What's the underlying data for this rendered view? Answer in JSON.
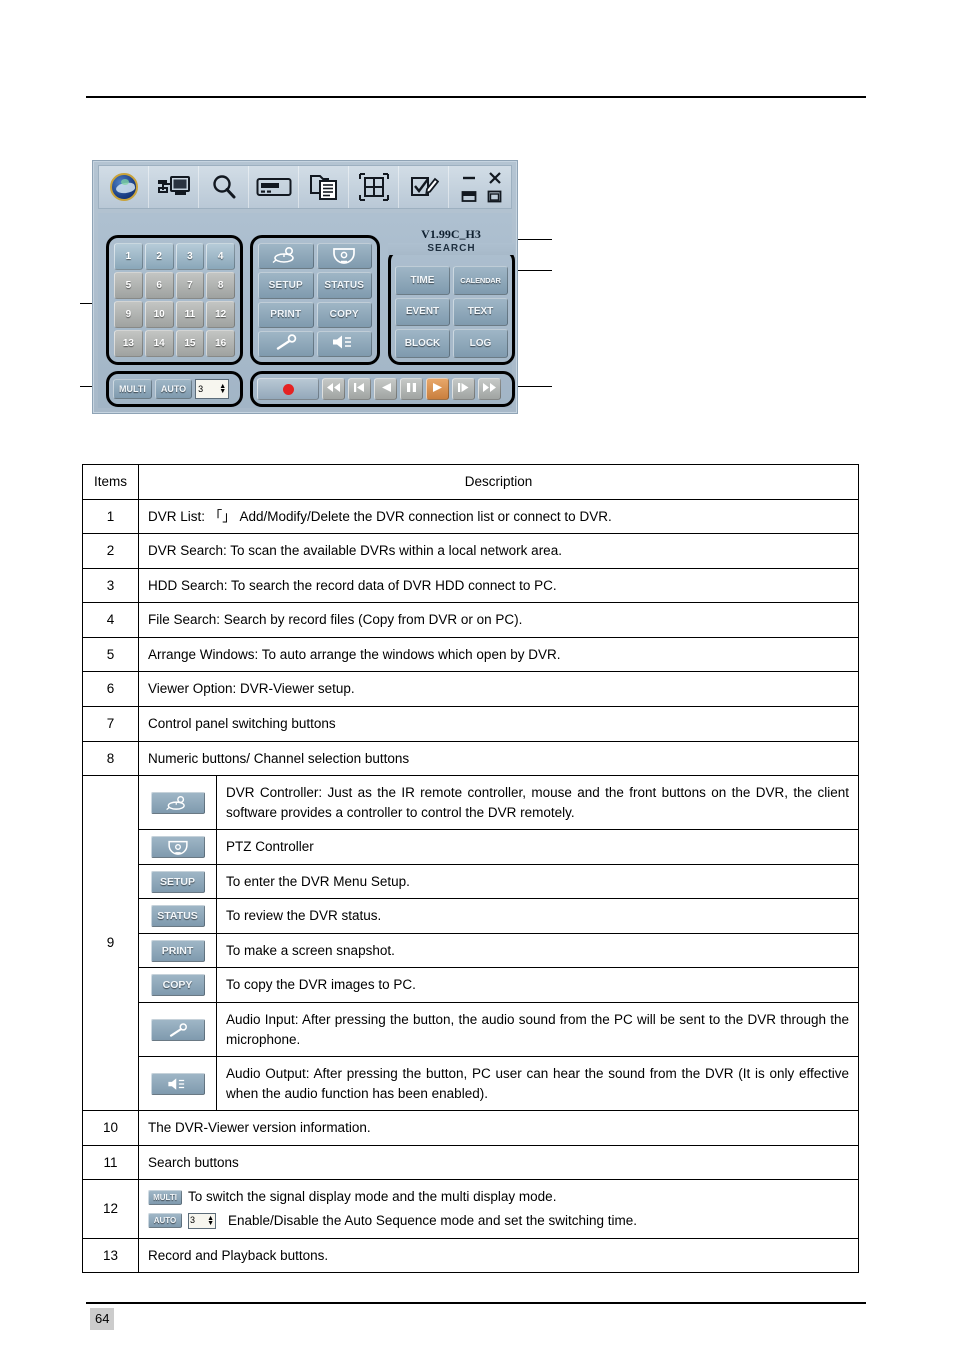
{
  "page": {
    "number": "64"
  },
  "figure": {
    "name": "dvr-viewer-control-panel",
    "version_label": "V1.99C_H3",
    "search_group_label": "SEARCH",
    "toolbar_icons": [
      "globe-logo-icon",
      "dvr-list-network-icon",
      "dvr-search-magnifier-icon",
      "hdd-search-device-icon",
      "file-search-copy-icon",
      "arrange-windows-icon",
      "viewer-option-checkbox-icon"
    ],
    "window_controls": [
      "minimize-icon",
      "close-icon",
      "restore-down-icon",
      "maximize-icon"
    ],
    "numeric_buttons": [
      "1",
      "2",
      "3",
      "4",
      "5",
      "6",
      "7",
      "8",
      "9",
      "10",
      "11",
      "12",
      "13",
      "14",
      "15",
      "16"
    ],
    "control_buttons": [
      {
        "label": "",
        "icon": "dvr-controller-icon"
      },
      {
        "label": "",
        "icon": "ptz-camera-icon"
      },
      {
        "label": "SETUP",
        "icon": ""
      },
      {
        "label": "STATUS",
        "icon": ""
      },
      {
        "label": "PRINT",
        "icon": ""
      },
      {
        "label": "COPY",
        "icon": ""
      },
      {
        "label": "",
        "icon": "microphone-icon"
      },
      {
        "label": "",
        "icon": "speaker-icon"
      }
    ],
    "search_buttons": [
      "TIME",
      "CALENDAR",
      "EVENT",
      "TEXT",
      "BLOCK",
      "LOG"
    ],
    "multi_label": "MULTI",
    "auto_label": "AUTO",
    "auto_value": "3",
    "playback_buttons": [
      "record-icon",
      "rewind-icon",
      "step-back-icon",
      "play-reverse-icon",
      "pause-icon",
      "play-icon",
      "step-forward-icon",
      "fast-forward-icon"
    ]
  },
  "table": {
    "headers": {
      "items": "Items",
      "description": "Description"
    },
    "rows": [
      {
        "item": "1",
        "text": "DVR List:  「」 Add/Modify/Delete the DVR connection list or connect to DVR."
      },
      {
        "item": "2",
        "text": "DVR Search: To scan the available DVRs within a local network area."
      },
      {
        "item": "3",
        "text": "HDD Search: To search the record data of DVR HDD connect to PC."
      },
      {
        "item": "4",
        "text": "File Search: Search by record files (Copy from DVR or on PC)."
      },
      {
        "item": "5",
        "text": "Arrange Windows: To auto arrange the windows which open by DVR."
      },
      {
        "item": "6",
        "text": "Viewer Option: DVR-Viewer setup."
      },
      {
        "item": "7",
        "text": "Control panel switching buttons"
      },
      {
        "item": "8",
        "text": "Numeric buttons/ Channel selection buttons"
      }
    ],
    "row9": {
      "item": "9",
      "sub_rows": [
        {
          "icon": "dvr-controller-icon",
          "chip_label": "",
          "text": "DVR Controller: Just as the IR remote controller, mouse and the front buttons on the DVR, the client software provides a controller to control the DVR remotely."
        },
        {
          "icon": "ptz-camera-icon",
          "chip_label": "",
          "text": "PTZ Controller"
        },
        {
          "icon": "text-chip",
          "chip_label": "SETUP",
          "text": "To enter the DVR Menu Setup."
        },
        {
          "icon": "text-chip",
          "chip_label": "STATUS",
          "text": "To review the DVR status."
        },
        {
          "icon": "text-chip",
          "chip_label": "PRINT",
          "text": "To make a screen snapshot."
        },
        {
          "icon": "text-chip",
          "chip_label": "COPY",
          "text": "To copy the DVR images to PC."
        },
        {
          "icon": "microphone-icon",
          "chip_label": "",
          "text": "Audio Input: After pressing the button, the audio sound from the PC will be sent to the DVR through the microphone."
        },
        {
          "icon": "speaker-icon",
          "chip_label": "",
          "text": "Audio Output: After pressing the button, PC user can hear the sound from the DVR (It is only effective when the audio function has been enabled)."
        }
      ]
    },
    "rows_tail": [
      {
        "item": "10",
        "text": "The DVR-Viewer version information."
      },
      {
        "item": "11",
        "text": "Search buttons"
      }
    ],
    "row12": {
      "item": "12",
      "line1_chip": "MULTI",
      "line1_text": "To switch the signal display mode and the multi display mode.",
      "line2_chip": "AUTO",
      "line2_value": "3",
      "line2_text": "Enable/Disable the Auto Sequence mode and set the switching time."
    },
    "row13": {
      "item": "13",
      "text": "Record and Playback buttons."
    }
  }
}
